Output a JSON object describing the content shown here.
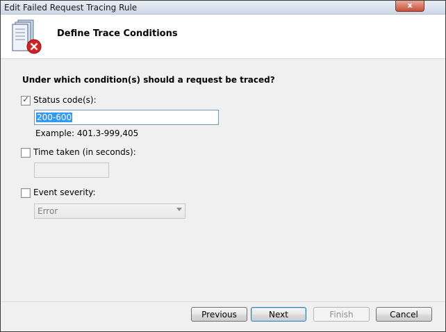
{
  "window": {
    "title": "Edit Failed Request Tracing Rule",
    "close_label": "x"
  },
  "header": {
    "title": "Define Trace Conditions",
    "icon": "document-error-icon"
  },
  "form": {
    "question": "Under which condition(s) should a request be traced?",
    "status_codes": {
      "label": "Status code(s):",
      "checked": true,
      "value": "200-600",
      "example": "Example: 401.3-999,405"
    },
    "time_taken": {
      "label": "Time taken (in seconds):",
      "checked": false,
      "value": ""
    },
    "event_severity": {
      "label": "Event severity:",
      "checked": false,
      "selected": "Error"
    }
  },
  "buttons": {
    "previous": "Previous",
    "next": "Next",
    "finish": "Finish",
    "cancel": "Cancel"
  }
}
